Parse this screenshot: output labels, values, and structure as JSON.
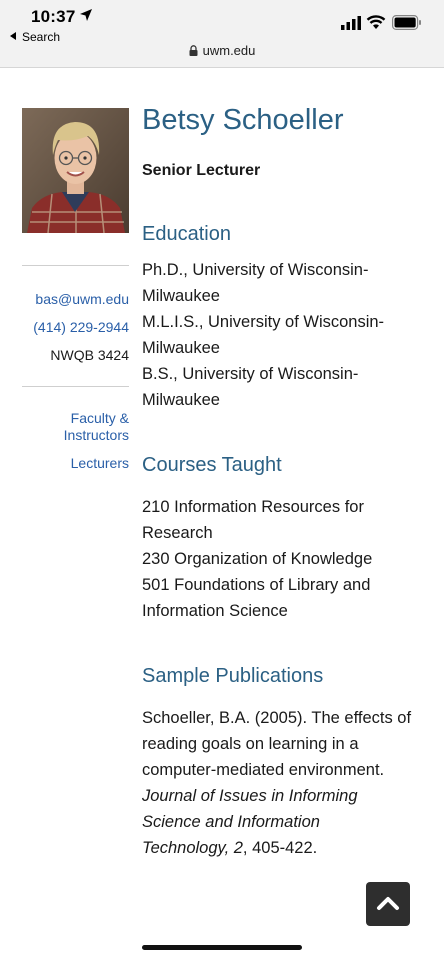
{
  "status_bar": {
    "time": "10:37",
    "back_app": "Search"
  },
  "url_bar": {
    "domain": "uwm.edu"
  },
  "profile": {
    "name": "Betsy Schoeller",
    "title": "Senior Lecturer",
    "email": "bas@uwm.edu",
    "phone": "(414) 229-2944",
    "office": "NWQB 3424",
    "nav": [
      "Faculty & Instructors",
      "Lecturers"
    ]
  },
  "education": {
    "heading": "Education",
    "lines": [
      "Ph.D., University of Wisconsin-",
      "Milwaukee",
      "M.L.I.S., University of Wisconsin-",
      "Milwaukee",
      "B.S., University of Wisconsin-",
      "Milwaukee"
    ]
  },
  "courses": {
    "heading": "Courses Taught",
    "lines": [
      "210 Information Resources for",
      "Research",
      "230 Organization of Knowledge",
      "501 Foundations of Library and",
      "Information Science"
    ]
  },
  "publications": {
    "heading": "Sample Publications",
    "lines_plain": [
      "Schoeller, B.A. (2005). The effects of",
      "reading goals on learning in a",
      "computer-mediated environment."
    ],
    "journal_line1": "Journal of Issues in Informing",
    "journal_line2": "Science and Information",
    "journal_line3_italic": "Technology, 2",
    "journal_line3_rest": ", 405-422."
  },
  "colors": {
    "heading": "#2b6084",
    "link": "#2a5fa8"
  },
  "icons": [
    "location-arrow-icon",
    "signal-icon",
    "wifi-icon",
    "battery-icon",
    "lock-icon",
    "chevron-up-icon"
  ]
}
